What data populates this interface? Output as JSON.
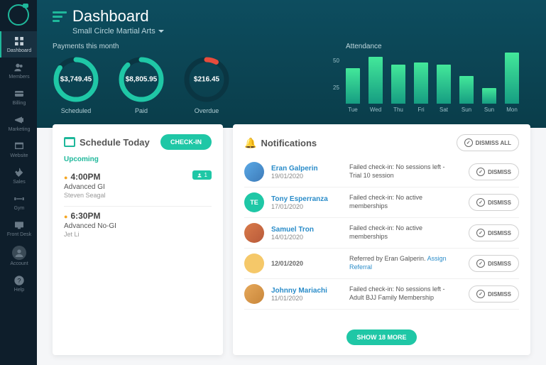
{
  "header": {
    "title": "Dashboard",
    "org": "Small Circle Martial Arts"
  },
  "sidebar": {
    "items": [
      "Dashboard",
      "Members",
      "Billing",
      "Marketing",
      "Website",
      "Sales",
      "Gym",
      "Front Desk",
      "Account",
      "Help"
    ]
  },
  "payments": {
    "title": "Payments this month",
    "items": [
      {
        "label": "Scheduled",
        "value": "$3,749.45",
        "pct": 85,
        "color": "#1fc7a6"
      },
      {
        "label": "Paid",
        "value": "$8,805.95",
        "pct": 88,
        "color": "#1fc7a6"
      },
      {
        "label": "Overdue",
        "value": "$216.45",
        "pct": 8,
        "color": "#e74c3c"
      }
    ]
  },
  "attendance": {
    "title": "Attendance"
  },
  "chart_data": {
    "type": "bar",
    "categories": [
      "Tue",
      "Wed",
      "Thu",
      "Fri",
      "Sat",
      "Sun",
      "Mon"
    ],
    "values": [
      35,
      46,
      38,
      40,
      38,
      27,
      15,
      50
    ],
    "ylim": [
      0,
      50
    ],
    "y_ticks": [
      25,
      50
    ]
  },
  "attendance_bars": [
    {
      "label": "Tue",
      "h": 35
    },
    {
      "label": "Wed",
      "h": 46
    },
    {
      "label": "Thu",
      "h": 38
    },
    {
      "label": "Fri",
      "h": 40
    },
    {
      "label": "Sat",
      "h": 38
    },
    {
      "label": "Sun",
      "h": 27
    },
    {
      "label": "Sun",
      "h": 15
    },
    {
      "label": "Mon",
      "h": 50
    }
  ],
  "schedule": {
    "title": "Schedule Today",
    "checkin": "CHECK-IN",
    "upcoming": "Upcoming",
    "items": [
      {
        "time": "4:00PM",
        "class": "Advanced GI",
        "instructor": "Steven Seagal",
        "attendees": 1
      },
      {
        "time": "6:30PM",
        "class": "Advanced No-GI",
        "instructor": "Jet Li",
        "attendees": null
      }
    ]
  },
  "notifications": {
    "title": "Notifications",
    "dismiss_all": "DISMISS ALL",
    "dismiss": "DISMISS",
    "show_more": "SHOW 18 MORE",
    "items": [
      {
        "name": "Eran Galperin",
        "date": "19/01/2020",
        "msg": "Failed check-in: No sessions left - Trial 10 session",
        "initials": ""
      },
      {
        "name": "Tony Esperranza",
        "date": "17/01/2020",
        "msg": "Failed check-in: No active memberships",
        "initials": "TE"
      },
      {
        "name": "Samuel Tron",
        "date": "14/01/2020",
        "msg": "Failed check-in: No active memberships",
        "initials": ""
      },
      {
        "name": "",
        "date": "12/01/2020",
        "msg": "Referred by Eran Galperin.",
        "link": "Assign Referral",
        "initials": ""
      },
      {
        "name": "Johnny Mariachi",
        "date": "11/01/2020",
        "msg": "Failed check-in: No sessions left - Adult BJJ Family Membership",
        "initials": ""
      }
    ]
  }
}
